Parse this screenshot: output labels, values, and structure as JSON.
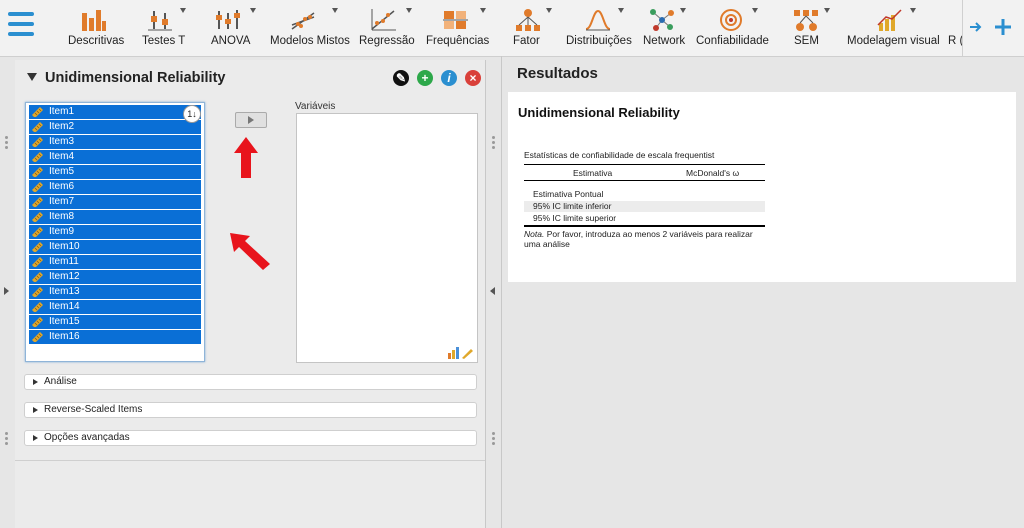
{
  "toolbar": {
    "tools": [
      {
        "label": "Descritivas"
      },
      {
        "label": "Testes T"
      },
      {
        "label": "ANOVA"
      },
      {
        "label": "Modelos Mistos"
      },
      {
        "label": "Regressão"
      },
      {
        "label": "Frequências"
      },
      {
        "label": "Fator"
      },
      {
        "label": "Distribuições"
      },
      {
        "label": "Network"
      },
      {
        "label": "Confiabilidade"
      },
      {
        "label": "SEM"
      },
      {
        "label": "Modelagem visual"
      },
      {
        "label": "R ("
      }
    ]
  },
  "analysis": {
    "title": "Unidimensional Reliability",
    "source_items": [
      "Item1",
      "Item2",
      "Item3",
      "Item4",
      "Item5",
      "Item6",
      "Item7",
      "Item8",
      "Item9",
      "Item10",
      "Item11",
      "Item12",
      "Item13",
      "Item14",
      "Item15",
      "Item16"
    ],
    "sort_icon": "1↓",
    "variables_label": "Variáveis",
    "sections": [
      "Análise",
      "Reverse-Scaled Items",
      "Opções avançadas"
    ]
  },
  "results": {
    "header": "Resultados",
    "title": "Unidimensional Reliability",
    "table_caption": "Estatísticas de confiabilidade de escala frequentist",
    "col_estimate": "Estimativa",
    "col_omega": "McDonald's ω",
    "rows": [
      "Estimativa Pontual",
      "95% IC limite inferior",
      "95% IC limite superior"
    ],
    "note_label": "Nota.",
    "note_text": " Por favor, introduza ao menos 2 variáveis para realizar uma análise"
  },
  "colors": {
    "accent": "#0a6fd6",
    "hamburger": "#2b8fd0",
    "annotation_arrow": "#e8141c"
  }
}
